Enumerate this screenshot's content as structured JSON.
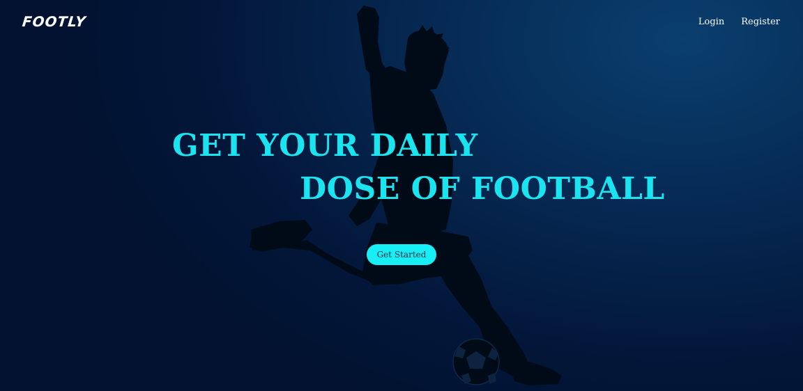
{
  "brand": {
    "logo_text": "FOOTLY"
  },
  "nav": {
    "login_label": "Login",
    "register_label": "Register"
  },
  "hero": {
    "headline_line1": "GET YOUR DAILY",
    "headline_line2": "DOSE OF FOOTBALL",
    "cta_label": "Get Started",
    "image": "footballer-kicking-ball-silhouette"
  },
  "colors": {
    "accent": "#19e4f0",
    "cta_background": "#18eef6",
    "background_dark": "#021230",
    "background_light": "#0a3f6e"
  }
}
